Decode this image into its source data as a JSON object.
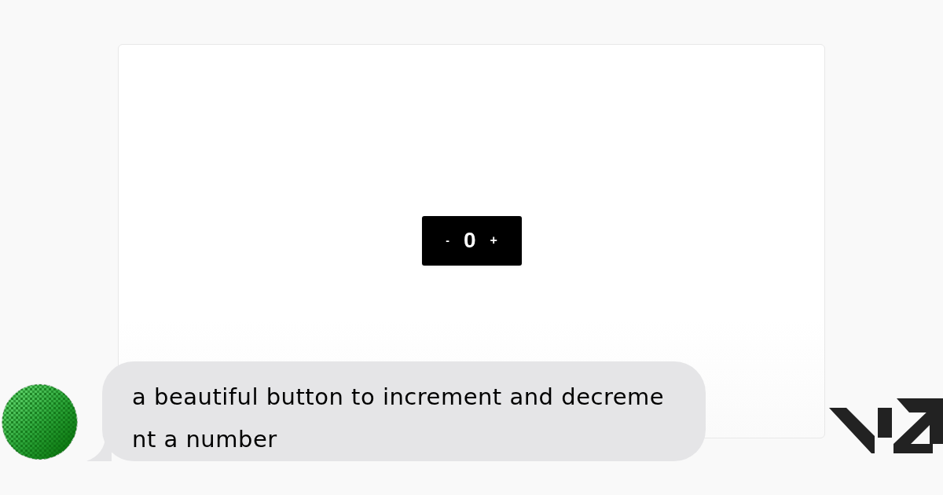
{
  "preview": {
    "counter": {
      "decrement": "-",
      "value": "0",
      "increment": "+"
    }
  },
  "chat": {
    "message": "a beautiful button to increment and decrement a number"
  }
}
